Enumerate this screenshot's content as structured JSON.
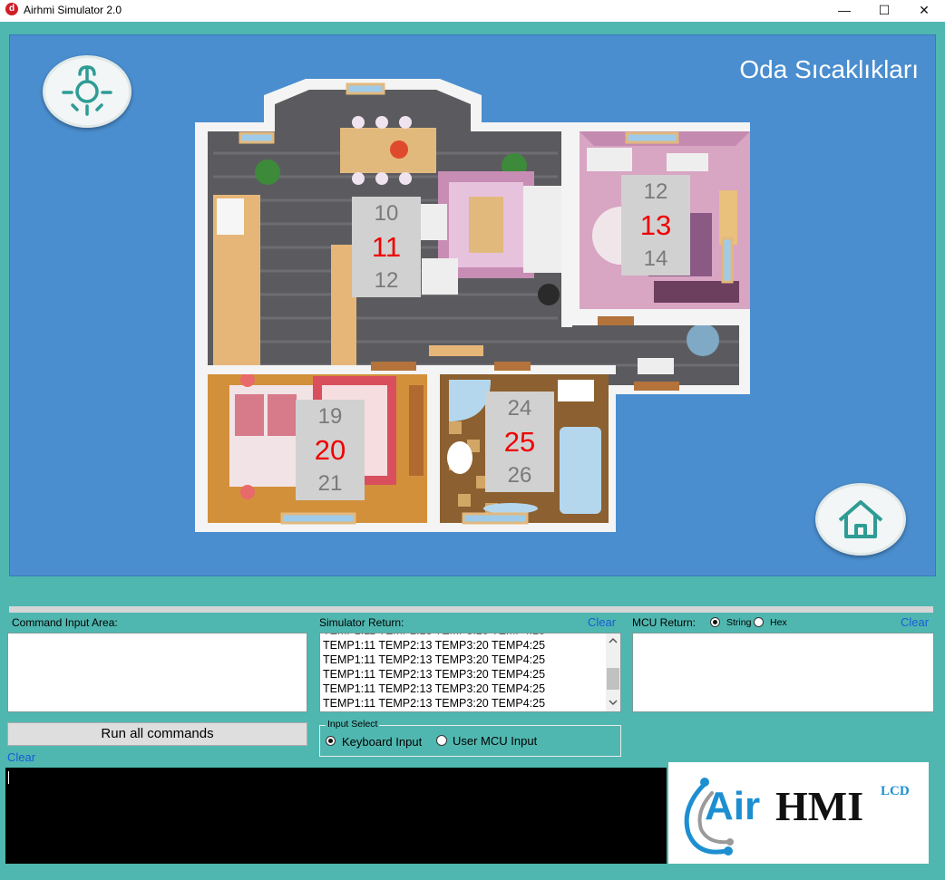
{
  "window": {
    "title": "Airhmi Simulator 2.0",
    "app_icon_letter": "d",
    "minimize_glyph": "—",
    "maximize_glyph": "☐",
    "close_glyph": "✕"
  },
  "screen": {
    "title": "Oda Sıcaklıkları",
    "background_color": "#4a8ecf",
    "light_button_icon": "light-bulb-icon",
    "home_button_icon": "home-icon",
    "rooms": [
      {
        "name": "living-room",
        "low": "10",
        "current": "11",
        "high": "12"
      },
      {
        "name": "bedroom-right",
        "low": "12",
        "current": "13",
        "high": "14"
      },
      {
        "name": "bedroom-left",
        "low": "19",
        "current": "20",
        "high": "21"
      },
      {
        "name": "bathroom",
        "low": "24",
        "current": "25",
        "high": "26"
      }
    ]
  },
  "command_input": {
    "label": "Command Input Area:",
    "value": "",
    "run_button": "Run all commands",
    "clear_link": "Clear"
  },
  "simulator_return": {
    "label": "Simulator Return:",
    "clear_link": "Clear",
    "lines": [
      "TEMP1:11 TEMP2:13 TEMP3:20 TEMP4:25",
      "TEMP1:11 TEMP2:13 TEMP3:20 TEMP4:25",
      "TEMP1:11 TEMP2:13 TEMP3:20 TEMP4:25",
      "TEMP1:11 TEMP2:13 TEMP3:20 TEMP4:25",
      "TEMP1:11 TEMP2:13 TEMP3:20 TEMP4:25"
    ]
  },
  "mcu_return": {
    "label": "MCU Return:",
    "options": [
      "String",
      "Hex"
    ],
    "selected": "String",
    "clear_link": "Clear",
    "value": ""
  },
  "input_select": {
    "legend": "Input Select",
    "options": [
      "Keyboard Input",
      "User MCU Input"
    ],
    "selected": "Keyboard Input"
  },
  "logo": {
    "text_air": "Air",
    "text_hmi": "HMI",
    "text_lcd": "LCD",
    "brand_color": "#1d8fd1"
  },
  "colors": {
    "window_bg": "#4fb7b0",
    "current_temp": "#ee0000",
    "range_temp": "#7a7a7a",
    "link": "#1a5bd6"
  }
}
